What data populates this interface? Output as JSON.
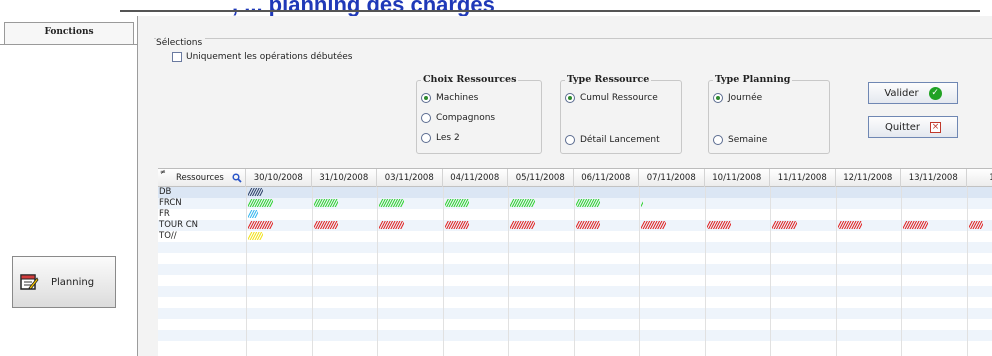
{
  "window": {
    "title_fragment": ", ... planning des charges"
  },
  "sidebar": {
    "tab_label": "Fonctions",
    "planning_button_label": "Planning",
    "planning_icon": "planning-calendar-icon"
  },
  "selections": {
    "legend": "Sélections",
    "only_started_label": "Uniquement les opérations débutées",
    "only_started_checked": false,
    "choix_ressources": {
      "title": "Choix Ressources",
      "options": [
        "Machines",
        "Compagnons",
        "Les 2"
      ],
      "selected": "Machines"
    },
    "type_ressource": {
      "title": "Type Ressource",
      "options": [
        "Cumul Ressource",
        "Détail Lancement"
      ],
      "selected": "Cumul Ressource"
    },
    "type_planning": {
      "title": "Type Planning",
      "options": [
        "Journée",
        "Semaine"
      ],
      "selected": "Journée"
    },
    "valider_label": "Valider",
    "quitter_label": "Quitter"
  },
  "grid": {
    "resource_header": "Ressources",
    "dates": [
      "30/10/2008",
      "31/10/2008",
      "03/11/2008",
      "04/11/2008",
      "05/11/2008",
      "06/11/2008",
      "07/11/2008",
      "10/11/2008",
      "11/11/2008",
      "12/11/2008",
      "13/11/2008",
      "14/1"
    ],
    "rows": [
      {
        "name": "DB",
        "color": "#2b3f66",
        "marks": [
          "//////"
        ],
        "selected": true
      },
      {
        "name": "FRCN",
        "color": "#2fd22f",
        "marks": [
          "//////////",
          "//////////",
          "//////////",
          "//////////",
          "//////////",
          "//////////",
          "/"
        ]
      },
      {
        "name": "FR",
        "color": "#33b5ee",
        "marks": [
          "////"
        ]
      },
      {
        "name": "TOUR CN",
        "color": "#e02020",
        "marks": [
          "//////////",
          "//////////",
          "//////////",
          "//////////",
          "//////////",
          "//////////",
          "//////////",
          "//////////",
          "//////////",
          "//////////",
          "//////////",
          "//////"
        ]
      },
      {
        "name": "TO//",
        "color": "#f2e21a",
        "marks": [
          "//////"
        ]
      },
      {
        "name": "",
        "color": "",
        "marks": []
      },
      {
        "name": "",
        "color": "",
        "marks": []
      },
      {
        "name": "",
        "color": "",
        "marks": []
      },
      {
        "name": "",
        "color": "",
        "marks": []
      },
      {
        "name": "",
        "color": "",
        "marks": []
      },
      {
        "name": "",
        "color": "",
        "marks": []
      },
      {
        "name": "",
        "color": "",
        "marks": []
      },
      {
        "name": "",
        "color": "",
        "marks": []
      },
      {
        "name": "",
        "color": "",
        "marks": []
      }
    ]
  }
}
